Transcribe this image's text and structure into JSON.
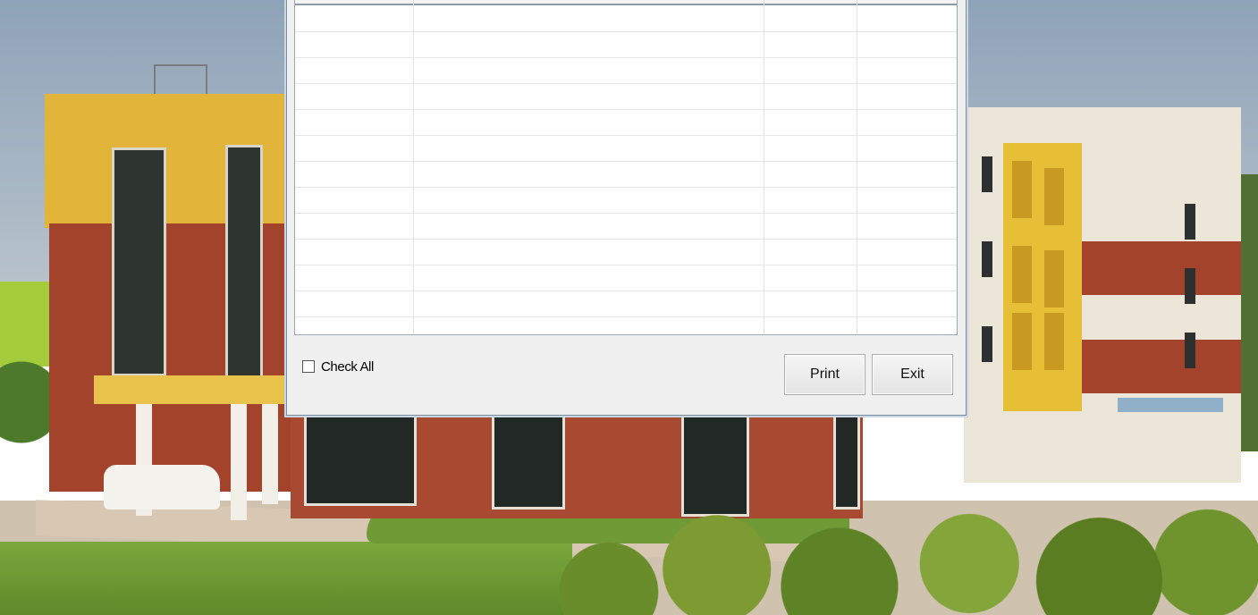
{
  "dialog": {
    "check_all_label": "Check All",
    "print_label": "Print",
    "exit_label": "Exit",
    "check_all_checked": false
  },
  "grid": {
    "column_count": 4,
    "visible_rows": 12,
    "rows": []
  },
  "colors": {
    "dialog_background": "#f0f0f0",
    "grid_background": "#ffffff",
    "dialog_border": "#7a8ea3"
  }
}
